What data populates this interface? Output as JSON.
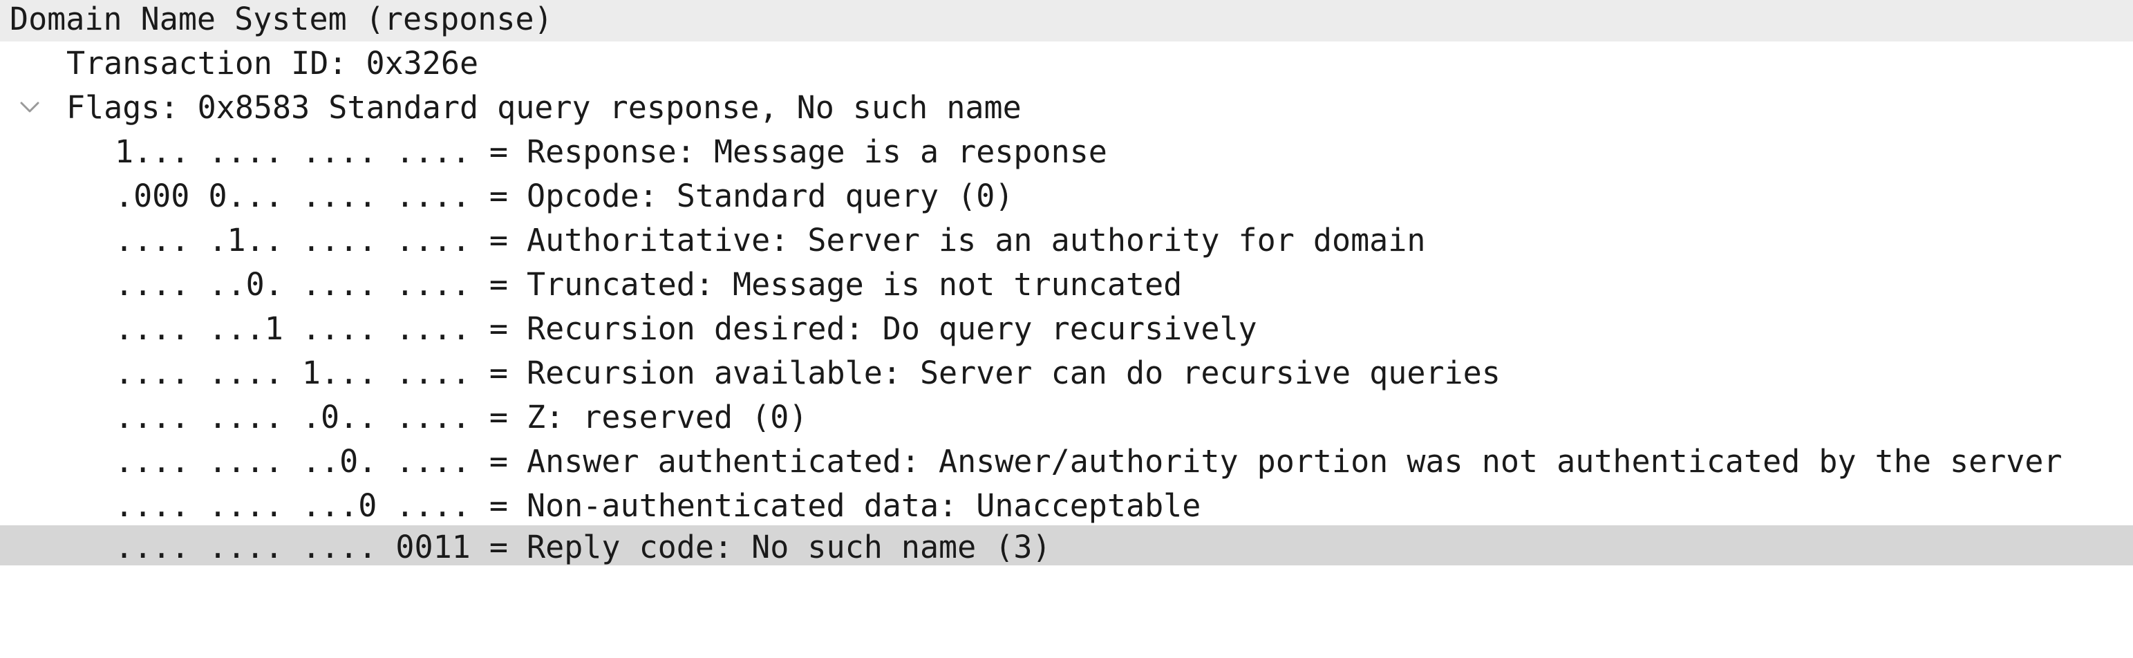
{
  "tree": {
    "root": "Domain Name System (response)",
    "transaction_id": "Transaction ID: 0x326e",
    "flags": {
      "label": "Flags: 0x8583 Standard query response, No such name",
      "expanded": true,
      "toggle_icon": "chevron-down-icon",
      "children": [
        "1... .... .... .... = Response: Message is a response",
        ".000 0... .... .... = Opcode: Standard query (0)",
        ".... .1.. .... .... = Authoritative: Server is an authority for domain",
        ".... ..0. .... .... = Truncated: Message is not truncated",
        ".... ...1 .... .... = Recursion desired: Do query recursively",
        ".... .... 1... .... = Recursion available: Server can do recursive queries",
        ".... .... .0.. .... = Z: reserved (0)",
        ".... .... ..0. .... = Answer authenticated: Answer/authority portion was not authenticated by the server",
        ".... .... ...0 .... = Non-authenticated data: Unacceptable",
        ".... .... .... 0011 = Reply code: No such name (3)"
      ]
    }
  },
  "colors": {
    "header_background": "#ececec",
    "selected_row_background": "#d6d6d6",
    "text": "#1a1a1a",
    "chevron": "#9a9a9a"
  }
}
